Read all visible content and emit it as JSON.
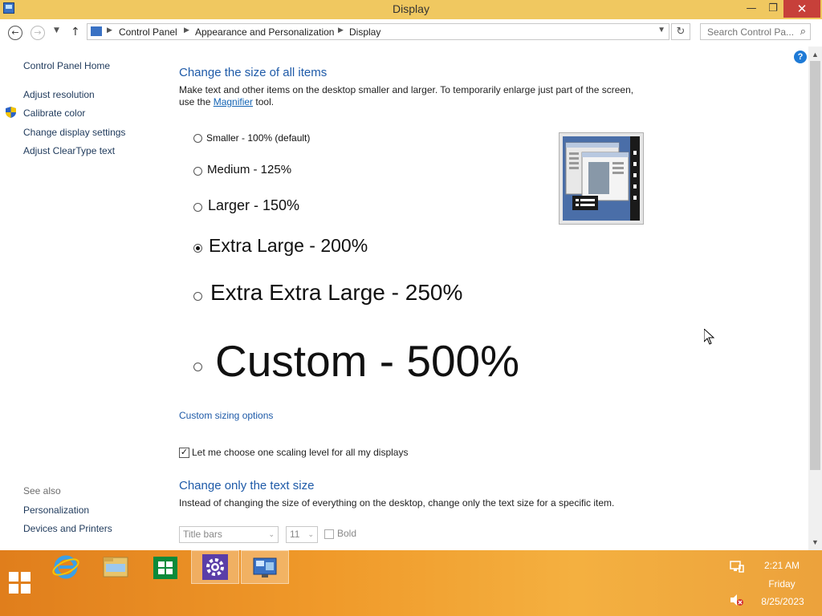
{
  "window": {
    "title": "Display",
    "minimize": "—",
    "maximize": "❐",
    "close": "✕"
  },
  "nav": {
    "breadcrumb": [
      "Control Panel",
      "Appearance and Personalization",
      "Display"
    ],
    "search_placeholder": "Search Control Pa..."
  },
  "sidebar": {
    "home": "Control Panel Home",
    "links": [
      "Adjust resolution",
      "Calibrate color",
      "Change display settings",
      "Adjust ClearType text"
    ],
    "see_also_label": "See also",
    "see_also": [
      "Personalization",
      "Devices and Printers"
    ]
  },
  "main": {
    "heading": "Change the size of all items",
    "description_pre": "Make text and other items on the desktop smaller and larger. To temporarily enlarge just part of the screen, use the ",
    "description_link": "Magnifier",
    "description_post": " tool.",
    "options": [
      {
        "label": "Smaller - 100% (default)",
        "checked": false
      },
      {
        "label": "Medium - 125%",
        "checked": false
      },
      {
        "label": "Larger - 150%",
        "checked": false
      },
      {
        "label": "Extra Large - 200%",
        "checked": true
      },
      {
        "label": "Extra Extra Large - 250%",
        "checked": false
      },
      {
        "label": "Custom - 500%",
        "checked": false
      }
    ],
    "custom_link": "Custom sizing options",
    "scaling_checkbox_label": "Let me choose one scaling level for all my displays",
    "scaling_checked": true,
    "text_heading": "Change only the text size",
    "text_description": "Instead of changing the size of everything on the desktop, change only the text size for a specific item.",
    "item_select": "Title bars",
    "size_select": "11",
    "bold_label": "Bold",
    "bold_checked": false
  },
  "taskbar": {
    "time": "2:21 AM",
    "day": "Friday",
    "date": "8/25/2023",
    "apps": [
      "internet-explorer",
      "file-explorer",
      "store",
      "settings",
      "display-control-panel"
    ]
  }
}
